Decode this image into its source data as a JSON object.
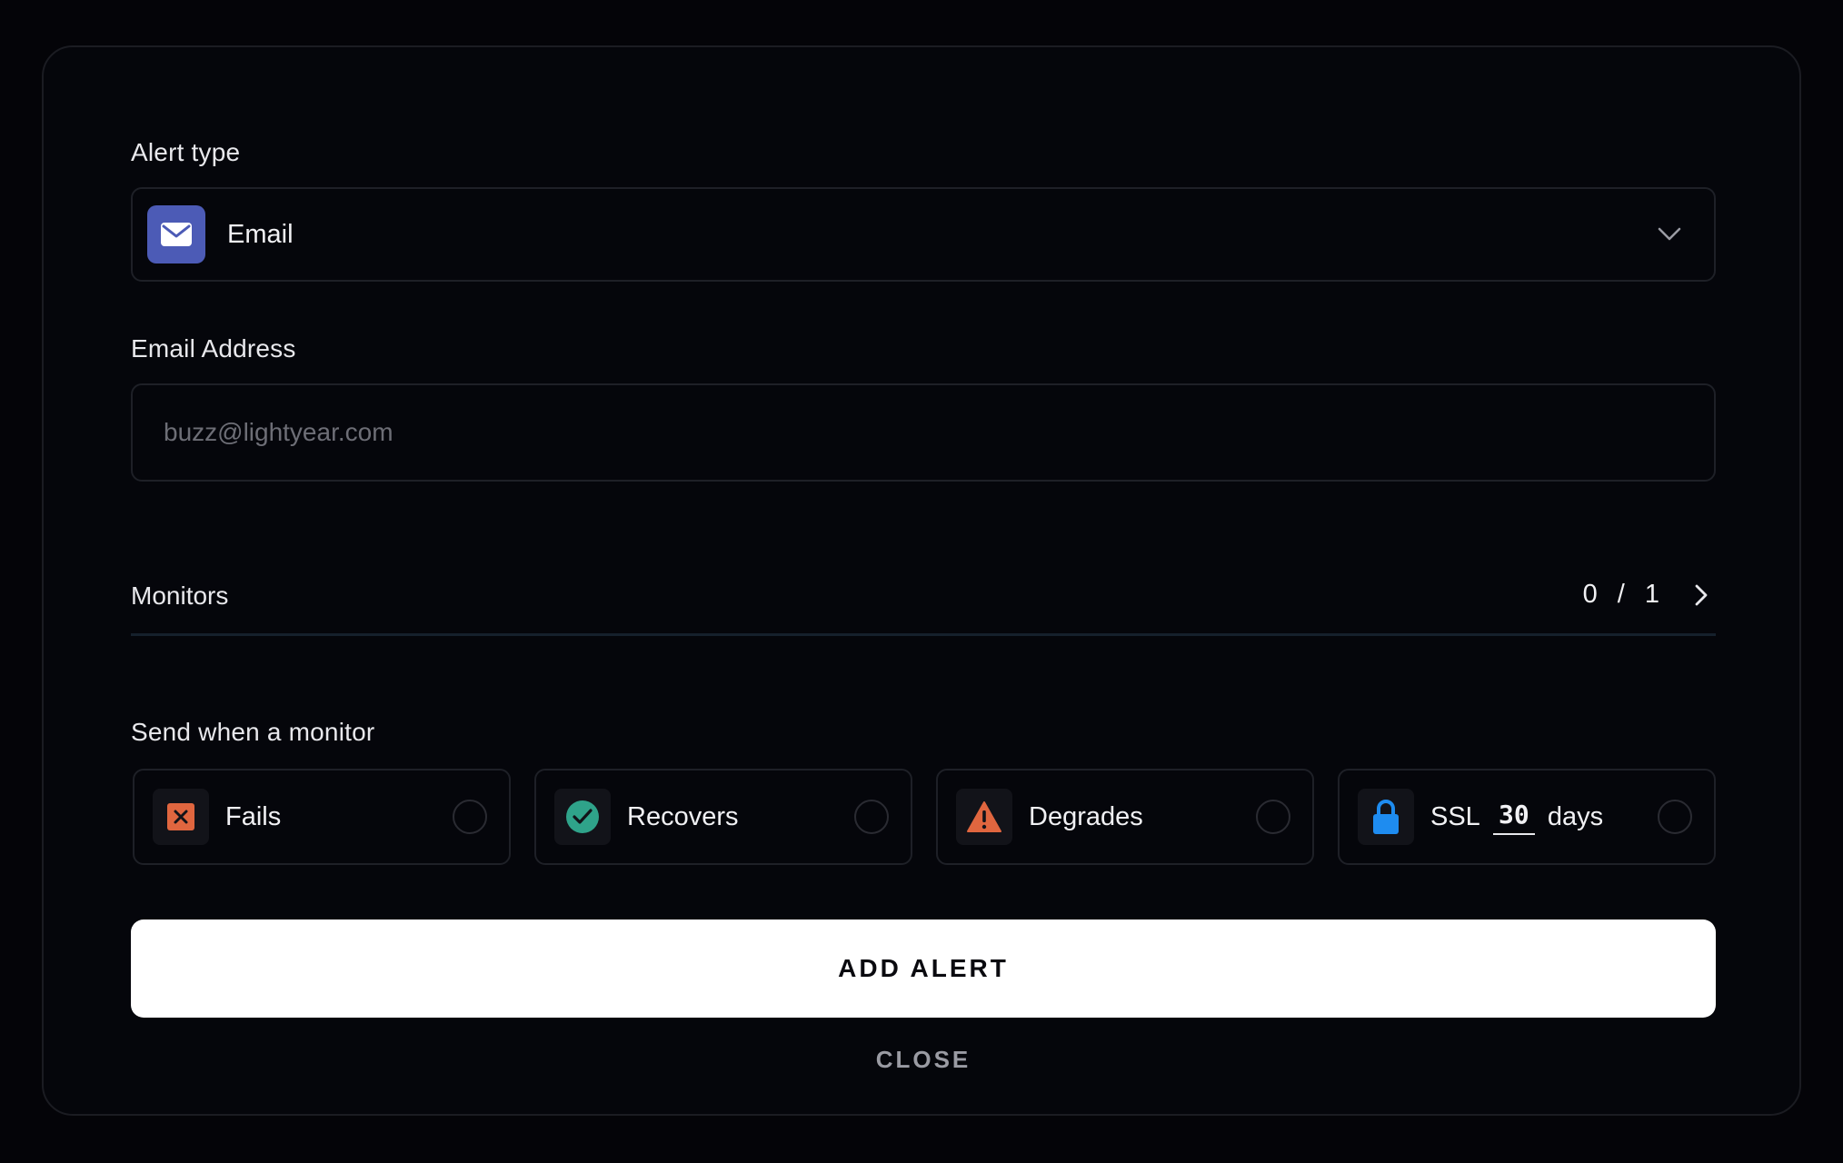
{
  "alert_type": {
    "label": "Alert type",
    "selected": "Email",
    "icon": "mail-icon",
    "icon_bg": "#4c5bb6"
  },
  "email": {
    "label": "Email Address",
    "placeholder": "buzz@lightyear.com",
    "value": ""
  },
  "monitors": {
    "label": "Monitors",
    "selected": "0",
    "separator": "/",
    "total": "1"
  },
  "send_when": {
    "label": "Send when a monitor",
    "options": [
      {
        "label": "Fails",
        "icon": "x-square-icon",
        "color": "#e0663f"
      },
      {
        "label": "Recovers",
        "icon": "check-circle-icon",
        "color": "#2fa38a"
      },
      {
        "label": "Degrades",
        "icon": "warning-triangle-icon",
        "color": "#e0663f"
      },
      {
        "label": "SSL",
        "icon": "lock-icon",
        "color": "#1e8cf0",
        "days": "30",
        "days_label": "days"
      }
    ]
  },
  "actions": {
    "add_label": "ADD ALERT",
    "close_label": "CLOSE"
  }
}
